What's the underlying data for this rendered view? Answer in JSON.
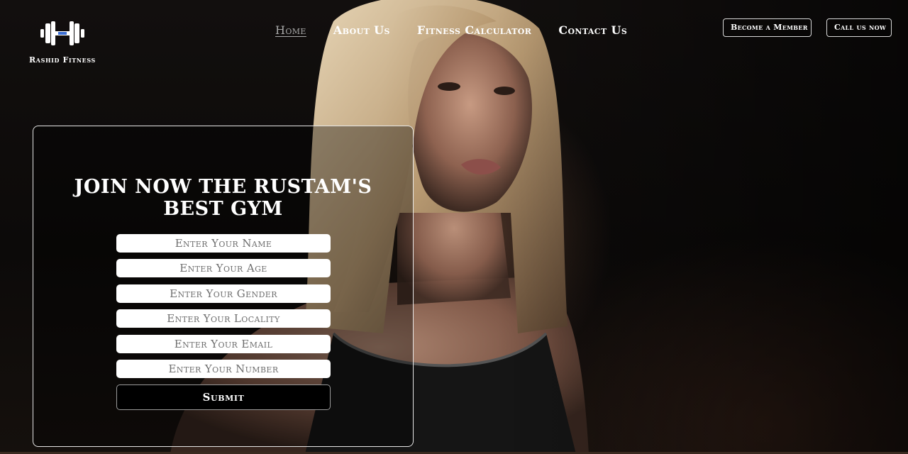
{
  "brand": {
    "name": "Rashid Fitness",
    "logo_icon": "dumbbell-icon"
  },
  "nav": {
    "items": [
      {
        "label": "Home",
        "active": true
      },
      {
        "label": "About Us",
        "active": false
      },
      {
        "label": "Fitness Calculator",
        "active": false
      },
      {
        "label": "Contact Us",
        "active": false
      }
    ]
  },
  "header_buttons": {
    "member": "Become a Member",
    "call": "Call us now"
  },
  "form": {
    "title_line1": "JOIN NOW THE RUSTAM'S",
    "title_line2": "BEST GYM",
    "fields": [
      {
        "placeholder": "Enter Your Name",
        "value": ""
      },
      {
        "placeholder": "Enter Your Age",
        "value": ""
      },
      {
        "placeholder": "Enter Your Gender",
        "value": ""
      },
      {
        "placeholder": "Enter Your Locality",
        "value": ""
      },
      {
        "placeholder": "Enter Your Email",
        "value": ""
      },
      {
        "placeholder": "Enter Your Number",
        "value": ""
      }
    ],
    "submit_label": "Submit"
  },
  "colors": {
    "background": "#0b0908",
    "text": "#ffffff",
    "active_nav": "#a8a8a8",
    "submit_bg": "#000000"
  }
}
